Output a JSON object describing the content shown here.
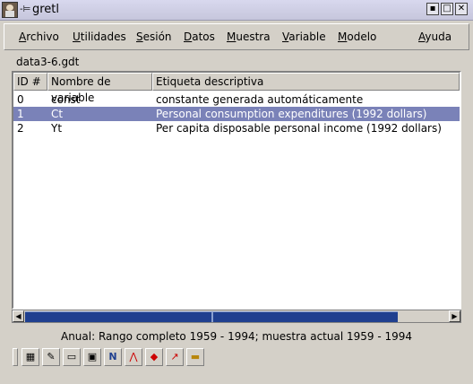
{
  "window": {
    "title": "gretl"
  },
  "menu": [
    {
      "label": "Archivo",
      "u": "A",
      "rest": "rchivo"
    },
    {
      "label": "Utilidades",
      "u": "U",
      "rest": "tilidades"
    },
    {
      "label": "Sesión",
      "u": "S",
      "rest": "esión"
    },
    {
      "label": "Datos",
      "u": "D",
      "rest": "atos"
    },
    {
      "label": "Muestra",
      "u": "M",
      "rest": "uestra"
    },
    {
      "label": "Variable",
      "u": "V",
      "rest": "ariable"
    },
    {
      "label": "Modelo",
      "u": "M",
      "rest": "odelo"
    },
    {
      "label": "Ayuda",
      "u": "A",
      "rest": "yuda"
    }
  ],
  "dataset": {
    "filename": "data3-6.gdt"
  },
  "table": {
    "headers": [
      "ID #",
      "Nombre de variable",
      "Etiqueta descriptiva"
    ],
    "rows": [
      {
        "id": "0",
        "name": "const",
        "label": "constante generada automáticamente"
      },
      {
        "id": "1",
        "name": "Ct",
        "label": "Personal consumption expenditures (1992 dollars)"
      },
      {
        "id": "2",
        "name": "Yt",
        "label": "Per capita disposable personal income (1992 dollars)"
      }
    ],
    "selected_row": 1
  },
  "status": {
    "text": "Anual: Rango completo 1959 - 1994; muestra actual 1959 - 1994"
  },
  "toolbar": {
    "icons": [
      "calculator-icon",
      "edit-icon",
      "terminal-icon",
      "session-icon",
      "notebook-icon",
      "pdf-icon",
      "model-icon",
      "plot-icon",
      "folder-icon"
    ],
    "glyphs": [
      "▦",
      "✎",
      "▭",
      "▣",
      "N",
      "⋀",
      "◆",
      "↗",
      "▬"
    ]
  },
  "colors": {
    "selection": "#7a82b8",
    "scroll_thumb": "#1f3f8f"
  }
}
